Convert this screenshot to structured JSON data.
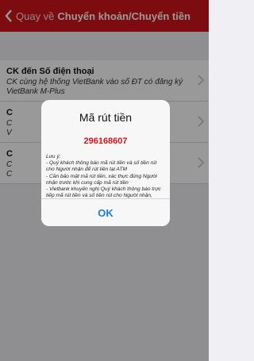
{
  "navbar": {
    "back_label": "Quay về",
    "title": "Chuyển khoản/Chuyển tiền"
  },
  "list": {
    "items": [
      {
        "title": "CK đến Số điện thoại",
        "subtitle": "CK cùng hệ thống VietBank vào số ĐT có đăng ký VietBank M-Plus"
      },
      {
        "title": "C",
        "subtitle": "C\nV"
      },
      {
        "title": "C",
        "subtitle": "C\nC"
      }
    ]
  },
  "dialog": {
    "title": "Mã rút tiền",
    "code": "296168607",
    "note": "Lưu ý:\n- Quý khách thông báo mã rút tiền và số tiền rút cho Người nhận để rút tiền tại ATM\n- Cần bảo mật mã rút tiền, xác thực đúng Người nhận trước khi cung cấp mã rút tiền\n- Vietbank khuyến nghị Quý khách thông báo trực tiếp mã rút tiền và số tiền rút cho Người nhận, không gửi thông tin qua tin nhắn",
    "ok_label": "OK"
  },
  "colors": {
    "brand": "#d0151b",
    "ok": "#1b7be5"
  }
}
